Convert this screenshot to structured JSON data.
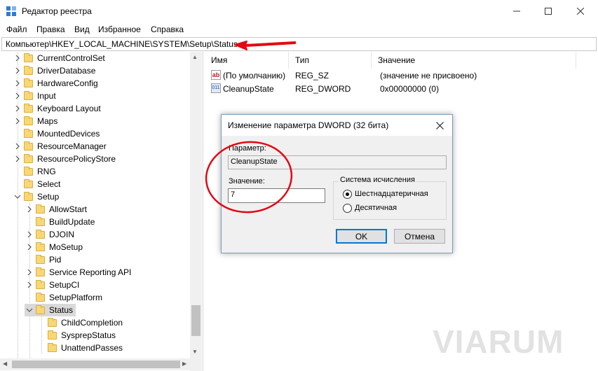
{
  "window": {
    "title": "Редактор реестра"
  },
  "menu": [
    "Файл",
    "Правка",
    "Вид",
    "Избранное",
    "Справка"
  ],
  "address": "Компьютер\\HKEY_LOCAL_MACHINE\\SYSTEM\\Setup\\Status",
  "tree": [
    {
      "label": "CurrentControlSet",
      "level": 1,
      "expandable": true,
      "expanded": false
    },
    {
      "label": "DriverDatabase",
      "level": 1,
      "expandable": true,
      "expanded": false
    },
    {
      "label": "HardwareConfig",
      "level": 1,
      "expandable": true,
      "expanded": false
    },
    {
      "label": "Input",
      "level": 1,
      "expandable": true,
      "expanded": false
    },
    {
      "label": "Keyboard Layout",
      "level": 1,
      "expandable": true,
      "expanded": false
    },
    {
      "label": "Maps",
      "level": 1,
      "expandable": true,
      "expanded": false
    },
    {
      "label": "MountedDevices",
      "level": 1,
      "expandable": false,
      "expanded": false
    },
    {
      "label": "ResourceManager",
      "level": 1,
      "expandable": true,
      "expanded": false
    },
    {
      "label": "ResourcePolicyStore",
      "level": 1,
      "expandable": true,
      "expanded": false
    },
    {
      "label": "RNG",
      "level": 1,
      "expandable": false,
      "expanded": false
    },
    {
      "label": "Select",
      "level": 1,
      "expandable": false,
      "expanded": false
    },
    {
      "label": "Setup",
      "level": 1,
      "expandable": true,
      "expanded": true
    },
    {
      "label": "AllowStart",
      "level": 2,
      "expandable": true,
      "expanded": false
    },
    {
      "label": "BuildUpdate",
      "level": 2,
      "expandable": false,
      "expanded": false
    },
    {
      "label": "DJOIN",
      "level": 2,
      "expandable": true,
      "expanded": false
    },
    {
      "label": "MoSetup",
      "level": 2,
      "expandable": true,
      "expanded": false
    },
    {
      "label": "Pid",
      "level": 2,
      "expandable": false,
      "expanded": false
    },
    {
      "label": "Service Reporting API",
      "level": 2,
      "expandable": true,
      "expanded": false
    },
    {
      "label": "SetupCI",
      "level": 2,
      "expandable": true,
      "expanded": false
    },
    {
      "label": "SetupPlatform",
      "level": 2,
      "expandable": false,
      "expanded": false
    },
    {
      "label": "Status",
      "level": 2,
      "expandable": true,
      "expanded": true,
      "selected": true
    },
    {
      "label": "ChildCompletion",
      "level": 3,
      "expandable": false,
      "expanded": false
    },
    {
      "label": "SysprepStatus",
      "level": 3,
      "expandable": false,
      "expanded": false
    },
    {
      "label": "UnattendPasses",
      "level": 3,
      "expandable": false,
      "expanded": false
    }
  ],
  "list": {
    "headers": [
      "Имя",
      "Тип",
      "Значение"
    ],
    "rows": [
      {
        "icon": "string-value-icon",
        "icon_text": "ab",
        "name": "(По умолчанию)",
        "type": "REG_SZ",
        "value": "(значение не присвоено)"
      },
      {
        "icon": "dword-value-icon",
        "icon_text": "011",
        "name": "CleanupState",
        "type": "REG_DWORD",
        "value": "0x00000000 (0)"
      }
    ]
  },
  "dialog": {
    "title": "Изменение параметра DWORD (32 бита)",
    "param_label": "Параметр:",
    "param_value": "CleanupState",
    "value_label": "Значение:",
    "value": "7",
    "base_group_label": "Система исчисления",
    "radio_hex": "Шестнадцатеричная",
    "radio_dec": "Десятичная",
    "selected_base": "hex",
    "ok": "OK",
    "cancel": "Отмена"
  },
  "watermark": "VIARUM",
  "colors": {
    "selection": "#d9d9d9",
    "annotation_red": "#e30613",
    "dialog_default_button": "#0078d7"
  }
}
